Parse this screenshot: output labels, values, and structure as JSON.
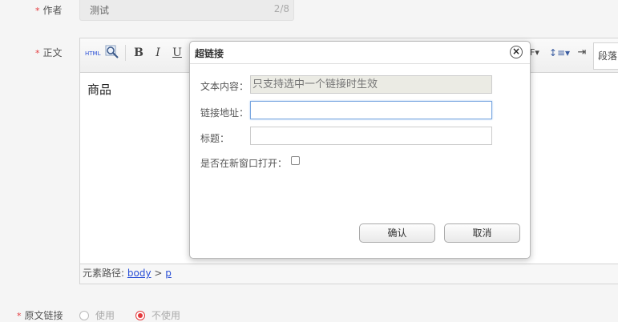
{
  "form": {
    "required_mark": "*",
    "author": {
      "label": "作者",
      "value": "测试",
      "counter": "2/8"
    },
    "content": {
      "label": "正文"
    },
    "original_link": {
      "label": "原文链接",
      "options": [
        "使用",
        "不使用"
      ],
      "selected": "不使用"
    }
  },
  "editor": {
    "toolbar": {
      "html_label": "HTML",
      "bold": "B",
      "italic": "I",
      "underline": "U",
      "format_label": "段落"
    },
    "body_text": "商品",
    "status": {
      "prefix": "元素路径:",
      "path_body": "body",
      "sep": ">",
      "path_p": "p"
    }
  },
  "dialog": {
    "title": "超链接",
    "close_glyph": "×",
    "text_label": "文本内容：",
    "text_value": "只支持选中一个链接时生效",
    "url_label": "链接地址：",
    "url_value": "",
    "title_label": "标题：",
    "title_value": "",
    "newwin_label": "是否在新窗口打开：",
    "newwin_checked": false,
    "confirm": "确认",
    "cancel": "取消"
  }
}
